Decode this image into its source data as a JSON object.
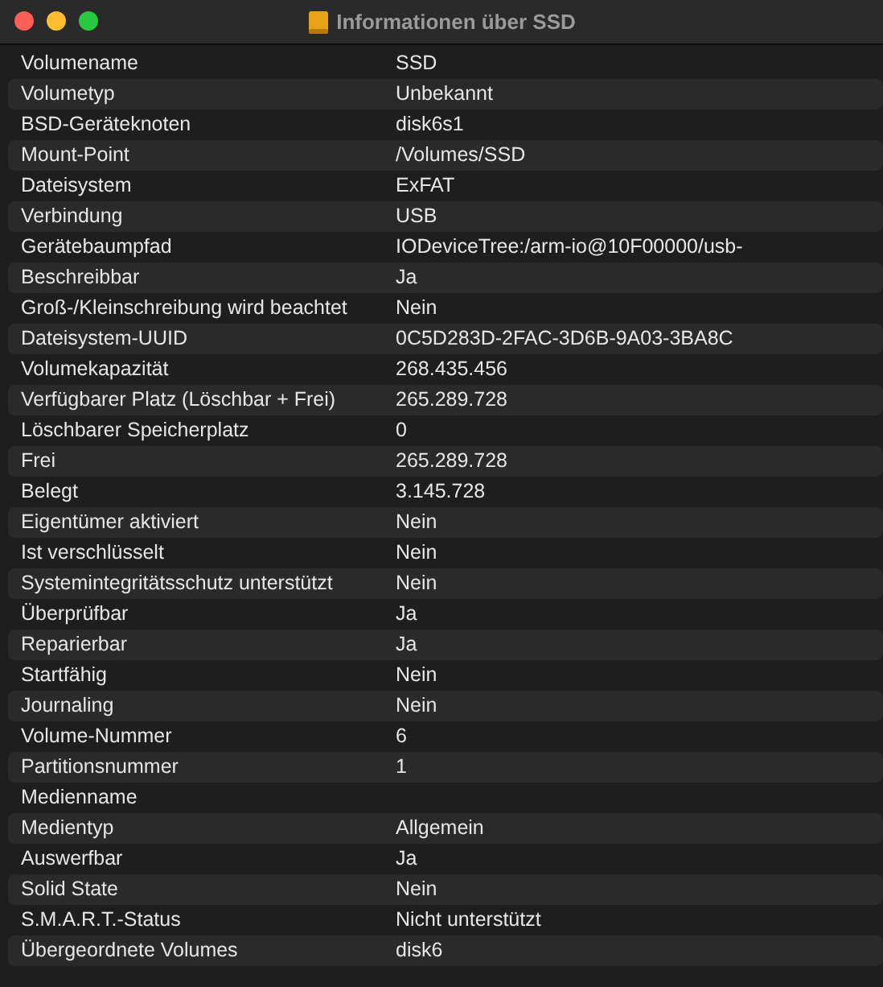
{
  "window": {
    "title": "Informationen über SSD"
  },
  "rows": [
    {
      "label": "Volumename",
      "value": "SSD"
    },
    {
      "label": "Volumetyp",
      "value": "Unbekannt"
    },
    {
      "label": "BSD-Geräteknoten",
      "value": "disk6s1"
    },
    {
      "label": "Mount-Point",
      "value": "/Volumes/SSD"
    },
    {
      "label": "Dateisystem",
      "value": "ExFAT"
    },
    {
      "label": "Verbindung",
      "value": "USB"
    },
    {
      "label": "Gerätebaumpfad",
      "value": "IODeviceTree:/arm-io@10F00000/usb-"
    },
    {
      "label": "Beschreibbar",
      "value": "Ja"
    },
    {
      "label": "Groß-/Kleinschreibung wird beachtet",
      "value": "Nein"
    },
    {
      "label": "Dateisystem-UUID",
      "value": "0C5D283D-2FAC-3D6B-9A03-3BA8C"
    },
    {
      "label": "Volumekapazität",
      "value": "268.435.456"
    },
    {
      "label": "Verfügbarer Platz (Löschbar + Frei)",
      "value": "265.289.728"
    },
    {
      "label": "Löschbarer Speicherplatz",
      "value": "0"
    },
    {
      "label": "Frei",
      "value": "265.289.728"
    },
    {
      "label": "Belegt",
      "value": "3.145.728"
    },
    {
      "label": "Eigentümer aktiviert",
      "value": "Nein"
    },
    {
      "label": "Ist verschlüsselt",
      "value": "Nein"
    },
    {
      "label": "Systemintegritätsschutz unterstützt",
      "value": "Nein"
    },
    {
      "label": "Überprüfbar",
      "value": "Ja"
    },
    {
      "label": "Reparierbar",
      "value": "Ja"
    },
    {
      "label": "Startfähig",
      "value": "Nein"
    },
    {
      "label": "Journaling",
      "value": "Nein"
    },
    {
      "label": "Volume-Nummer",
      "value": "6"
    },
    {
      "label": "Partitionsnummer",
      "value": "1"
    },
    {
      "label": "Medienname"
    },
    {
      "label": "Medientyp",
      "value": "Allgemein"
    },
    {
      "label": "Auswerfbar",
      "value": "Ja"
    },
    {
      "label": "Solid State",
      "value": "Nein"
    },
    {
      "label": "S.M.A.R.T.-Status",
      "value": "Nicht unterstützt"
    },
    {
      "label": "Übergeordnete Volumes",
      "value": "disk6"
    }
  ]
}
